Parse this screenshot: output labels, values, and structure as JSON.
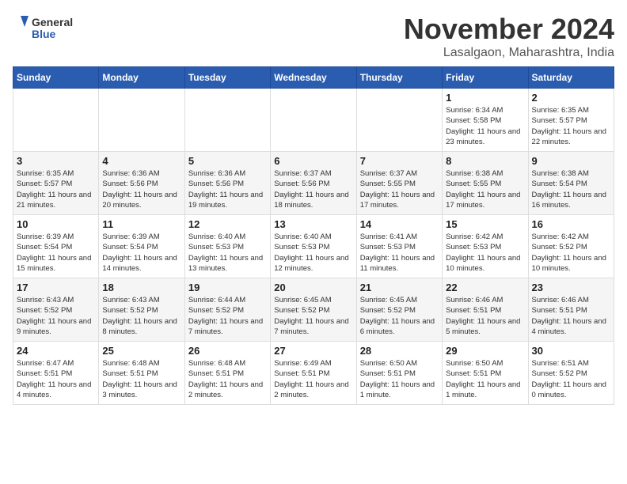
{
  "logo": {
    "general": "General",
    "blue": "Blue"
  },
  "title": "November 2024",
  "subtitle": "Lasalgaon, Maharashtra, India",
  "headers": [
    "Sunday",
    "Monday",
    "Tuesday",
    "Wednesday",
    "Thursday",
    "Friday",
    "Saturday"
  ],
  "weeks": [
    [
      {
        "day": "",
        "info": ""
      },
      {
        "day": "",
        "info": ""
      },
      {
        "day": "",
        "info": ""
      },
      {
        "day": "",
        "info": ""
      },
      {
        "day": "",
        "info": ""
      },
      {
        "day": "1",
        "info": "Sunrise: 6:34 AM\nSunset: 5:58 PM\nDaylight: 11 hours\nand 23 minutes."
      },
      {
        "day": "2",
        "info": "Sunrise: 6:35 AM\nSunset: 5:57 PM\nDaylight: 11 hours\nand 22 minutes."
      }
    ],
    [
      {
        "day": "3",
        "info": "Sunrise: 6:35 AM\nSunset: 5:57 PM\nDaylight: 11 hours\nand 21 minutes."
      },
      {
        "day": "4",
        "info": "Sunrise: 6:36 AM\nSunset: 5:56 PM\nDaylight: 11 hours\nand 20 minutes."
      },
      {
        "day": "5",
        "info": "Sunrise: 6:36 AM\nSunset: 5:56 PM\nDaylight: 11 hours\nand 19 minutes."
      },
      {
        "day": "6",
        "info": "Sunrise: 6:37 AM\nSunset: 5:56 PM\nDaylight: 11 hours\nand 18 minutes."
      },
      {
        "day": "7",
        "info": "Sunrise: 6:37 AM\nSunset: 5:55 PM\nDaylight: 11 hours\nand 17 minutes."
      },
      {
        "day": "8",
        "info": "Sunrise: 6:38 AM\nSunset: 5:55 PM\nDaylight: 11 hours\nand 17 minutes."
      },
      {
        "day": "9",
        "info": "Sunrise: 6:38 AM\nSunset: 5:54 PM\nDaylight: 11 hours\nand 16 minutes."
      }
    ],
    [
      {
        "day": "10",
        "info": "Sunrise: 6:39 AM\nSunset: 5:54 PM\nDaylight: 11 hours\nand 15 minutes."
      },
      {
        "day": "11",
        "info": "Sunrise: 6:39 AM\nSunset: 5:54 PM\nDaylight: 11 hours\nand 14 minutes."
      },
      {
        "day": "12",
        "info": "Sunrise: 6:40 AM\nSunset: 5:53 PM\nDaylight: 11 hours\nand 13 minutes."
      },
      {
        "day": "13",
        "info": "Sunrise: 6:40 AM\nSunset: 5:53 PM\nDaylight: 11 hours\nand 12 minutes."
      },
      {
        "day": "14",
        "info": "Sunrise: 6:41 AM\nSunset: 5:53 PM\nDaylight: 11 hours\nand 11 minutes."
      },
      {
        "day": "15",
        "info": "Sunrise: 6:42 AM\nSunset: 5:53 PM\nDaylight: 11 hours\nand 10 minutes."
      },
      {
        "day": "16",
        "info": "Sunrise: 6:42 AM\nSunset: 5:52 PM\nDaylight: 11 hours\nand 10 minutes."
      }
    ],
    [
      {
        "day": "17",
        "info": "Sunrise: 6:43 AM\nSunset: 5:52 PM\nDaylight: 11 hours\nand 9 minutes."
      },
      {
        "day": "18",
        "info": "Sunrise: 6:43 AM\nSunset: 5:52 PM\nDaylight: 11 hours\nand 8 minutes."
      },
      {
        "day": "19",
        "info": "Sunrise: 6:44 AM\nSunset: 5:52 PM\nDaylight: 11 hours\nand 7 minutes."
      },
      {
        "day": "20",
        "info": "Sunrise: 6:45 AM\nSunset: 5:52 PM\nDaylight: 11 hours\nand 7 minutes."
      },
      {
        "day": "21",
        "info": "Sunrise: 6:45 AM\nSunset: 5:52 PM\nDaylight: 11 hours\nand 6 minutes."
      },
      {
        "day": "22",
        "info": "Sunrise: 6:46 AM\nSunset: 5:51 PM\nDaylight: 11 hours\nand 5 minutes."
      },
      {
        "day": "23",
        "info": "Sunrise: 6:46 AM\nSunset: 5:51 PM\nDaylight: 11 hours\nand 4 minutes."
      }
    ],
    [
      {
        "day": "24",
        "info": "Sunrise: 6:47 AM\nSunset: 5:51 PM\nDaylight: 11 hours\nand 4 minutes."
      },
      {
        "day": "25",
        "info": "Sunrise: 6:48 AM\nSunset: 5:51 PM\nDaylight: 11 hours\nand 3 minutes."
      },
      {
        "day": "26",
        "info": "Sunrise: 6:48 AM\nSunset: 5:51 PM\nDaylight: 11 hours\nand 2 minutes."
      },
      {
        "day": "27",
        "info": "Sunrise: 6:49 AM\nSunset: 5:51 PM\nDaylight: 11 hours\nand 2 minutes."
      },
      {
        "day": "28",
        "info": "Sunrise: 6:50 AM\nSunset: 5:51 PM\nDaylight: 11 hours\nand 1 minute."
      },
      {
        "day": "29",
        "info": "Sunrise: 6:50 AM\nSunset: 5:51 PM\nDaylight: 11 hours\nand 1 minute."
      },
      {
        "day": "30",
        "info": "Sunrise: 6:51 AM\nSunset: 5:52 PM\nDaylight: 11 hours\nand 0 minutes."
      }
    ]
  ]
}
